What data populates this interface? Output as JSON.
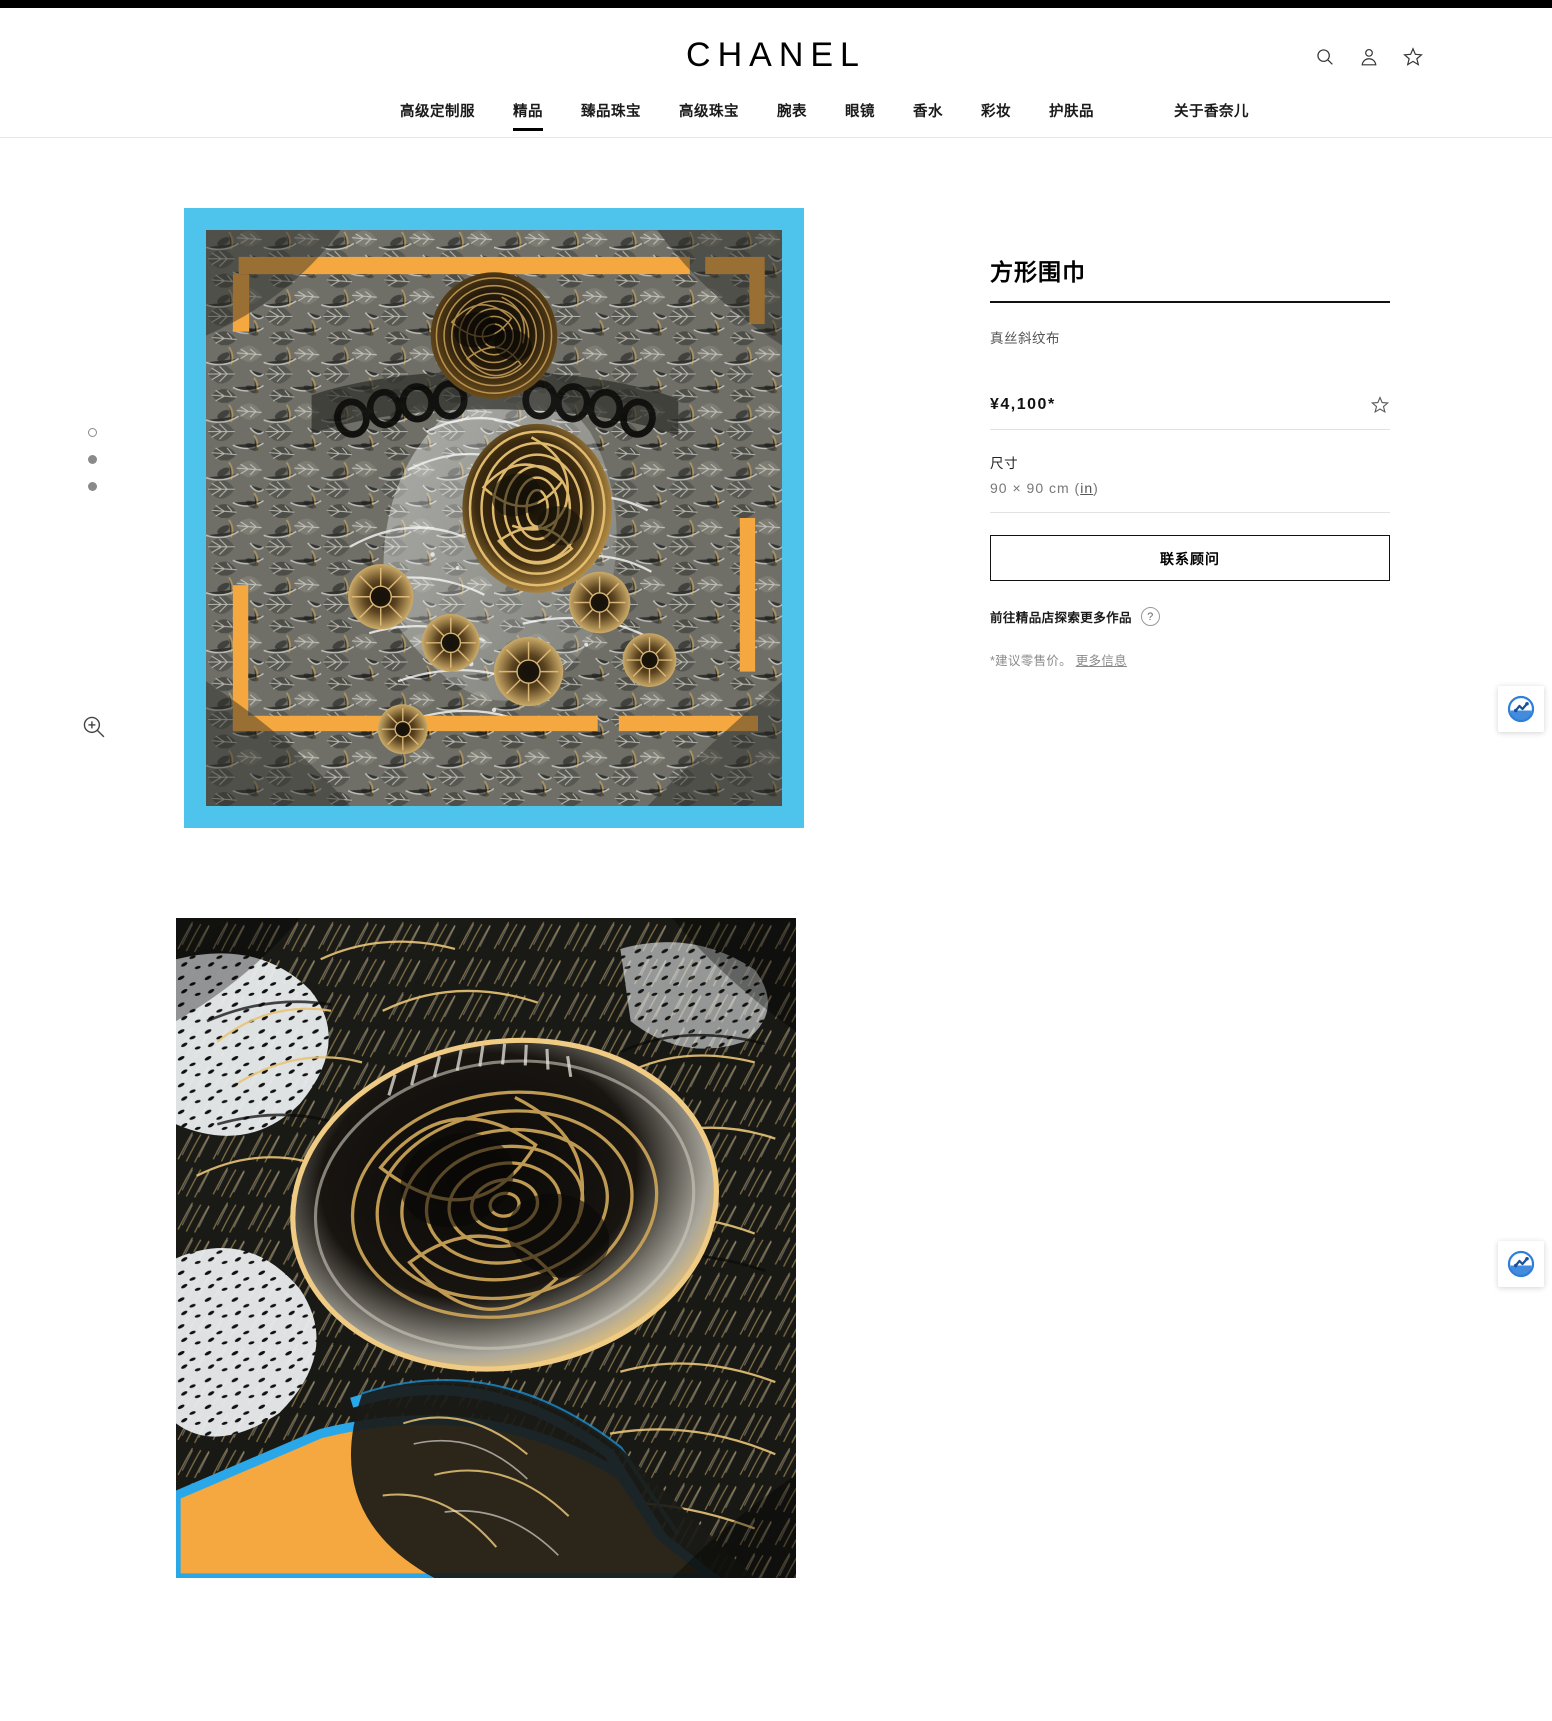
{
  "brand": {
    "name": "CHANEL"
  },
  "header": {
    "icons": [
      {
        "name": "search-icon",
        "label": "搜索"
      },
      {
        "name": "account-icon",
        "label": "账户"
      },
      {
        "name": "wishlist-star-icon",
        "label": "心愿单"
      }
    ],
    "nav": [
      {
        "label": "高级定制服",
        "active": false
      },
      {
        "label": "精品",
        "active": true
      },
      {
        "label": "臻品珠宝",
        "active": false
      },
      {
        "label": "高级珠宝",
        "active": false
      },
      {
        "label": "腕表",
        "active": false
      },
      {
        "label": "眼镜",
        "active": false
      },
      {
        "label": "香水",
        "active": false
      },
      {
        "label": "彩妆",
        "active": false
      },
      {
        "label": "护肤品",
        "active": false
      },
      {
        "label": "关于香奈儿",
        "active": false,
        "spaced": true
      }
    ]
  },
  "gallery": {
    "thumbs": [
      {
        "name": "gallery-dot-1",
        "state": "hollow"
      },
      {
        "name": "gallery-dot-2",
        "state": "solid"
      },
      {
        "name": "gallery-dot-3",
        "state": "solid"
      }
    ],
    "zoom_icon": "zoom-in-icon",
    "hero_border_color": "#4ec3ec",
    "hero_accent_color": "#f5a83f",
    "hero_alt": "方形围巾 真丝斜纹布 全幅印花",
    "detail_alt": "方形围巾 细节图"
  },
  "product": {
    "title": "方形围巾",
    "material": "真丝斜纹布",
    "price": "¥4,100*",
    "wishlist_icon": "star-outline-icon",
    "size_label": "尺寸",
    "size_value": "90 × 90 cm (",
    "size_unit_link": "in",
    "size_value_end": ")",
    "cta_label": "联系顾问",
    "boutique_text": "前往精品店探索更多作品",
    "help_icon_label": "?",
    "note_prefix": "*建议零售价。",
    "note_link": "更多信息"
  },
  "widgets": [
    {
      "name": "chat-widget-top",
      "color": "#1f6fd0"
    },
    {
      "name": "chat-widget-bottom",
      "color": "#1f6fd0"
    }
  ]
}
